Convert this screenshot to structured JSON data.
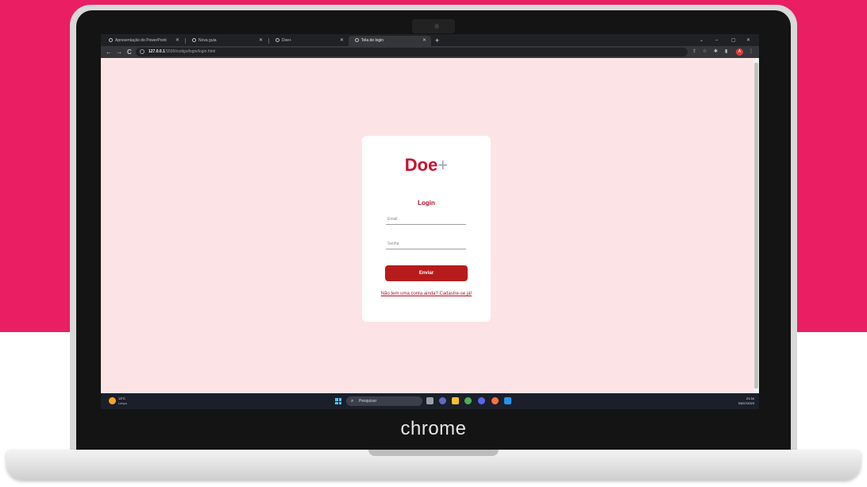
{
  "browser": {
    "tabs": [
      {
        "label": "Apresentação do PowerPoint",
        "active": false
      },
      {
        "label": "Nova guia",
        "active": false
      },
      {
        "label": "Doe+",
        "active": false
      },
      {
        "label": "Tela de login",
        "active": true
      }
    ],
    "new_tab": "+",
    "window_controls": {
      "minimize": "–",
      "restore": "▢",
      "close": "✕",
      "tab_search": "⌄"
    },
    "nav": {
      "back": "←",
      "forward": "→",
      "reload": "C"
    },
    "address": {
      "host": "127.0.0.1",
      "rest": ":5500/codigo/login/login.html"
    },
    "toolbar_icons": {
      "share": "⇪",
      "bookmark": "☆",
      "extensions": "✱",
      "sidepanel": "▮",
      "profile": "A",
      "menu": "⋮"
    }
  },
  "page": {
    "logo": {
      "text": "Doe",
      "plus": "+"
    },
    "title": "Login",
    "email_placeholder": "Email",
    "password_placeholder": "Senha",
    "submit_label": "Enviar",
    "signup_link": "Não tem uma conta ainda? Cadastre-se já!"
  },
  "taskbar": {
    "weather": {
      "temp": "13°C",
      "desc": "Limpo"
    },
    "search_placeholder": "Pesquisar",
    "time": "21:34",
    "date": "03/07/2023"
  },
  "device": {
    "brand": "chrome"
  },
  "colors": {
    "background": "#e91e63",
    "page_bg": "#fce4e6",
    "accent": "#b71c1c"
  }
}
